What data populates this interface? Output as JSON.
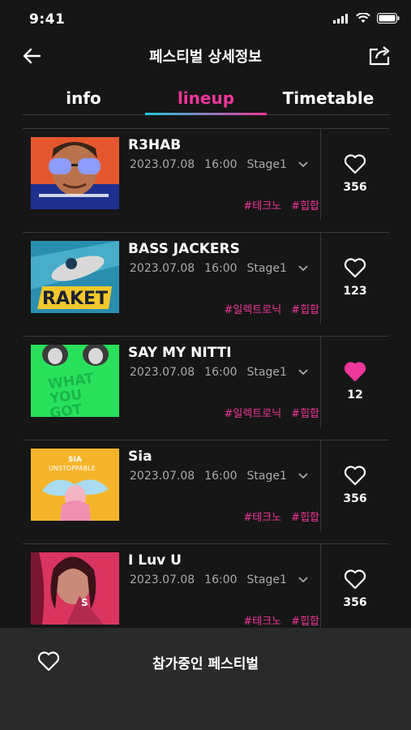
{
  "status": {
    "time": "9:41"
  },
  "header": {
    "title": "페스티벌 상세정보"
  },
  "tabs": [
    {
      "label": "info",
      "active": false
    },
    {
      "label": "lineup",
      "active": true
    },
    {
      "label": "Timetable",
      "active": false
    }
  ],
  "lineup": [
    {
      "artist": "R3HAB",
      "date": "2023.07.08",
      "time": "16:00",
      "stage": "Stage1",
      "tags": [
        "#테크노",
        "#힙합"
      ],
      "likes": "356",
      "liked": false
    },
    {
      "artist": "BASS JACKERS",
      "date": "2023.07.08",
      "time": "16:00",
      "stage": "Stage1",
      "tags": [
        "#일렉트로닉",
        "#힙합"
      ],
      "likes": "123",
      "liked": false
    },
    {
      "artist": "SAY MY NITTI",
      "date": "2023.07.08",
      "time": "16:00",
      "stage": "Stage1",
      "tags": [
        "#일렉트로닉",
        "#힙합"
      ],
      "likes": "12",
      "liked": true
    },
    {
      "artist": "Sia",
      "date": "2023.07.08",
      "time": "16:00",
      "stage": "Stage1",
      "tags": [
        "#테크노",
        "#힙합"
      ],
      "likes": "356",
      "liked": false
    },
    {
      "artist": "I Luv U",
      "date": "2023.07.08",
      "time": "16:00",
      "stage": "Stage1",
      "tags": [
        "#테크노",
        "#힙합"
      ],
      "likes": "356",
      "liked": false
    }
  ],
  "bottom": {
    "label": "참가중인 페스티벌"
  },
  "colors": {
    "accent": "#f0369a",
    "tab_gradient_start": "#1fc7d8",
    "background": "#161616",
    "bottom_bar": "#2a2a2a"
  },
  "icons": {
    "back": "arrow-left-icon",
    "share": "share-icon",
    "like": "heart-icon"
  }
}
